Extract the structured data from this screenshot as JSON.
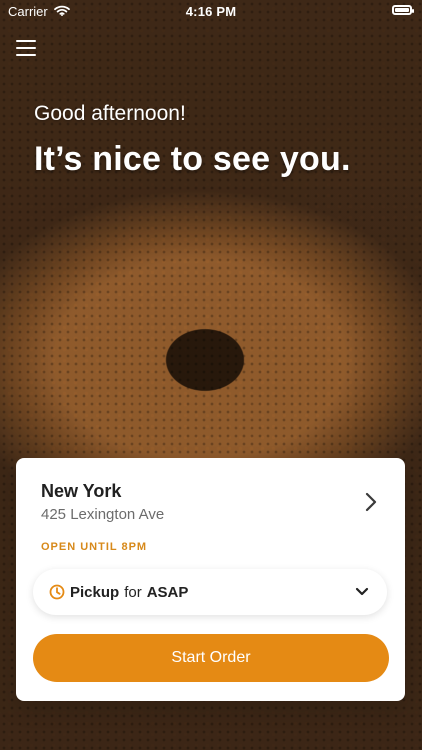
{
  "status_bar": {
    "carrier": "Carrier",
    "time": "4:16 PM",
    "icons": {
      "wifi": "wifi-icon",
      "battery": "battery-icon"
    }
  },
  "header": {
    "menu_icon": "hamburger-menu-icon",
    "greeting": "Good afternoon!",
    "headline": "It’s nice to see you."
  },
  "store_card": {
    "name": "New York",
    "address": "425 Lexington Ave",
    "open_status": "OPEN UNTIL 8PM",
    "chevron_icon": "chevron-right-icon"
  },
  "pickup_selector": {
    "mode": "Pickup",
    "connector": "for",
    "time": "ASAP",
    "clock_icon": "clock-icon",
    "dropdown_icon": "chevron-down-icon"
  },
  "cta": {
    "label": "Start Order"
  },
  "colors": {
    "accent": "#e58a14",
    "status_accent": "#d7891a",
    "card_bg": "#ffffff",
    "text_primary": "#202020",
    "text_secondary": "#6c6c6c"
  }
}
